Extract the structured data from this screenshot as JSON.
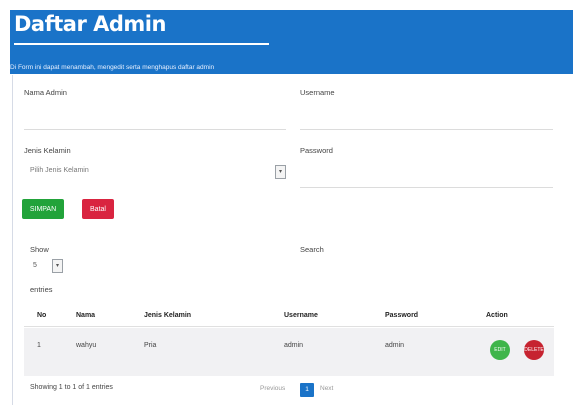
{
  "header": {
    "title": "Daftar Admin",
    "description": "Di Form ini dapat menambah, mengedit serta menghapus daftar admin"
  },
  "form": {
    "nama_label": "Nama Admin",
    "username_label": "Username",
    "jk_label": "Jenis Kelamin",
    "jk_placeholder": "Pilih Jenis Kelamin",
    "password_label": "Password",
    "save_label": "SIMPAN",
    "cancel_label": "Batal"
  },
  "table_controls": {
    "show_label": "Show",
    "length_value": "5",
    "entries_label": "entries",
    "search_label": "Search"
  },
  "table": {
    "columns": [
      "No",
      "Nama",
      "Jenis Kelamin",
      "Username",
      "Password",
      "Action"
    ],
    "rows": [
      {
        "no": "1",
        "nama": "wahyu",
        "jk": "Pria",
        "username": "admin",
        "password": "admin"
      }
    ],
    "edit_label": "EDIT",
    "delete_label": "DELETE"
  },
  "footer": {
    "info": "Showing 1 to 1 of 1 entries",
    "prev_label": "Previous",
    "current_page": "1",
    "next_label": "Next"
  },
  "colors": {
    "header_bg": "#1a73c8",
    "save": "#22a33a",
    "cancel": "#d92440",
    "edit": "#3fb54a",
    "delete": "#c62330"
  },
  "icons": [
    "chevron-down-icon",
    "edit-icon",
    "delete-icon"
  ]
}
